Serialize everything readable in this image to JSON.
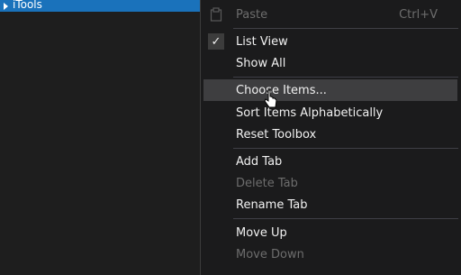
{
  "toolbox": {
    "tree_item_label": "iTools"
  },
  "menu": {
    "paste": {
      "label": "Paste",
      "shortcut": "Ctrl+V",
      "icon": "paste-icon"
    },
    "list_view": {
      "label": "List View",
      "check": "✓"
    },
    "show_all": {
      "label": "Show All"
    },
    "choose_items": {
      "label": "Choose Items..."
    },
    "sort_items": {
      "label": "Sort Items Alphabetically"
    },
    "reset_toolbox": {
      "label": "Reset Toolbox"
    },
    "add_tab": {
      "label": "Add Tab"
    },
    "delete_tab": {
      "label": "Delete Tab"
    },
    "rename_tab": {
      "label": "Rename Tab"
    },
    "move_up": {
      "label": "Move Up"
    },
    "move_down": {
      "label": "Move Down"
    }
  },
  "colors": {
    "selection": "#1a72bb",
    "menu_background": "#1b1b1c",
    "hover": "#3e3e40",
    "disabled_text": "#6d6d6d"
  }
}
